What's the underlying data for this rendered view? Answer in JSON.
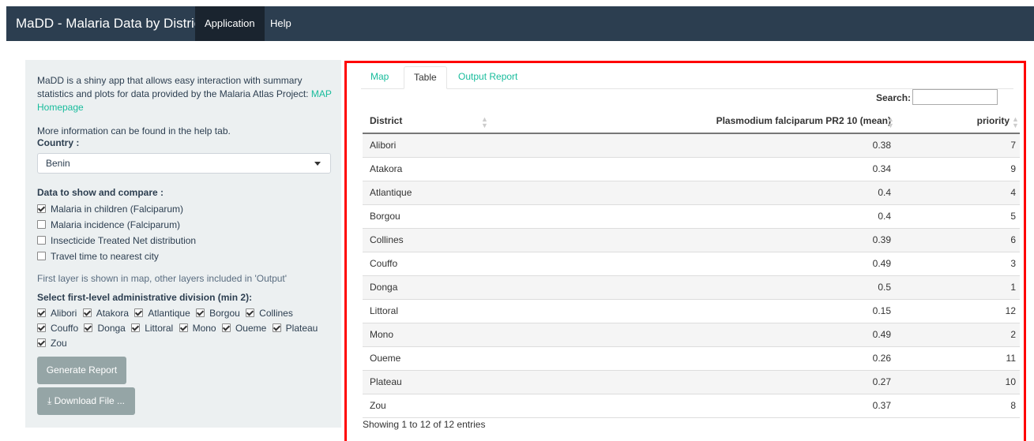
{
  "navbar": {
    "brand": "MaDD - Malaria Data by District",
    "tabs": [
      "Application",
      "Help"
    ]
  },
  "sidebar": {
    "intro": "MaDD is a shiny app that allows easy interaction with summary statistics and plots for data provided by the Malaria Atlas Project:",
    "intro_link": "MAP Homepage",
    "more_info": "More information can be found in the help tab.",
    "country_label": "Country :",
    "country_value": "Benin",
    "data_label": "Data to show and compare :",
    "data_options": [
      {
        "label": "Malaria in children (Falciparum)",
        "checked": true
      },
      {
        "label": "Malaria incidence (Falciparum)",
        "checked": false
      },
      {
        "label": "Insecticide Treated Net distribution",
        "checked": false
      },
      {
        "label": "Travel time to nearest city",
        "checked": false
      }
    ],
    "layer_note": "First layer is shown in map, other layers included in 'Output'",
    "admin_label": "Select first-level administrative division (min 2):",
    "admin_options": [
      "Alibori",
      "Atakora",
      "Atlantique",
      "Borgou",
      "Collines",
      "Couffo",
      "Donga",
      "Littoral",
      "Mono",
      "Oueme",
      "Plateau",
      "Zou"
    ],
    "generate_button": "Generate Report",
    "download_button": "Download File ..."
  },
  "main": {
    "tabs": [
      "Map",
      "Table",
      "Output Report"
    ],
    "active_tab": "Table",
    "search_label": "Search:",
    "columns": [
      "District",
      "Plasmodium falciparum PR2 10 (mean)",
      "priority"
    ],
    "rows": [
      [
        "Alibori",
        "0.38",
        "7"
      ],
      [
        "Atakora",
        "0.34",
        "9"
      ],
      [
        "Atlantique",
        "0.4",
        "4"
      ],
      [
        "Borgou",
        "0.4",
        "5"
      ],
      [
        "Collines",
        "0.39",
        "6"
      ],
      [
        "Couffo",
        "0.49",
        "3"
      ],
      [
        "Donga",
        "0.5",
        "1"
      ],
      [
        "Littoral",
        "0.15",
        "12"
      ],
      [
        "Mono",
        "0.49",
        "2"
      ],
      [
        "Oueme",
        "0.26",
        "11"
      ],
      [
        "Plateau",
        "0.27",
        "10"
      ],
      [
        "Zou",
        "0.37",
        "8"
      ]
    ],
    "info": "Showing 1 to 12 of 12 entries"
  },
  "colors": {
    "navbar": "#2c3e50",
    "link": "#18bc9c",
    "sidebar_bg": "#ecf0f1",
    "button": "#95a5a6",
    "highlight_border": "#ff0000"
  }
}
